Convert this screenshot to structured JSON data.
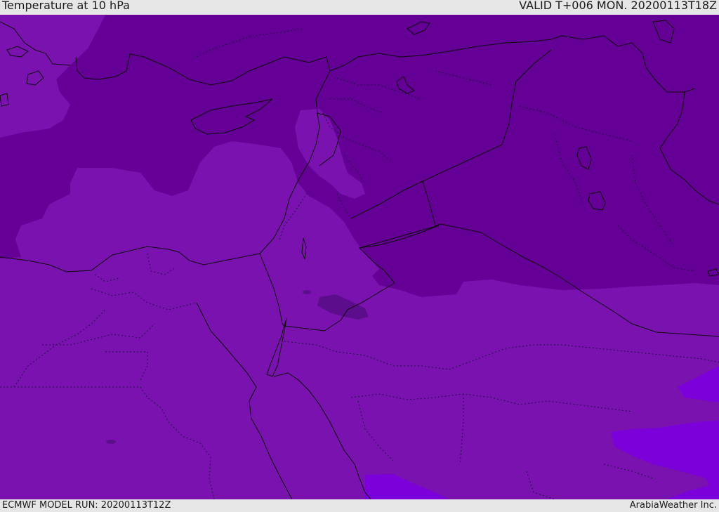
{
  "header": {
    "title": "Temperature at 10 hPa",
    "valid": "VALID T+006 MON. 20200113T18Z"
  },
  "footer": {
    "model_run": "ECMWF MODEL RUN: 20200113T12Z",
    "credit": "ArabiaWeather Inc."
  },
  "colors": {
    "dark_band": "#650096",
    "mid_band": "#7a12b0",
    "light_band": "#7c00da",
    "small_cell": "#5c0d8c"
  }
}
